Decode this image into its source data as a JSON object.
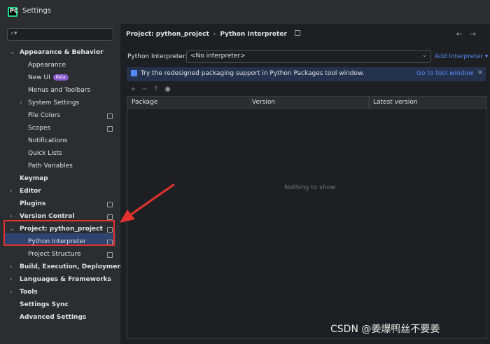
{
  "window": {
    "title": "Settings"
  },
  "sidebar": {
    "search_placeholder": "",
    "items": [
      {
        "label": "Appearance & Behavior",
        "level": 0,
        "expanded": true,
        "bold": true
      },
      {
        "label": "Appearance",
        "level": 1
      },
      {
        "label": "New UI",
        "level": 1,
        "badge": "Beta"
      },
      {
        "label": "Menus and Toolbars",
        "level": 1
      },
      {
        "label": "System Settings",
        "level": 1,
        "collapsed": true
      },
      {
        "label": "File Colors",
        "level": 1,
        "pin": true
      },
      {
        "label": "Scopes",
        "level": 1,
        "pin": true
      },
      {
        "label": "Notifications",
        "level": 1
      },
      {
        "label": "Quick Lists",
        "level": 1
      },
      {
        "label": "Path Variables",
        "level": 1
      },
      {
        "label": "Keymap",
        "level": 0,
        "bold": true
      },
      {
        "label": "Editor",
        "level": 0,
        "bold": true,
        "collapsed": true
      },
      {
        "label": "Plugins",
        "level": 0,
        "bold": true,
        "pin": true
      },
      {
        "label": "Version Control",
        "level": 0,
        "bold": true,
        "collapsed": true,
        "pin": true
      },
      {
        "label": "Project: python_project",
        "level": 0,
        "bold": true,
        "expanded": true,
        "pin": true
      },
      {
        "label": "Python Interpreter",
        "level": 1,
        "pin": true,
        "selected": true
      },
      {
        "label": "Project Structure",
        "level": 1,
        "pin": true
      },
      {
        "label": "Build, Execution, Deployment",
        "level": 0,
        "bold": true,
        "collapsed": true
      },
      {
        "label": "Languages & Frameworks",
        "level": 0,
        "bold": true,
        "collapsed": true
      },
      {
        "label": "Tools",
        "level": 0,
        "bold": true,
        "collapsed": true
      },
      {
        "label": "Settings Sync",
        "level": 0,
        "bold": true
      },
      {
        "label": "Advanced Settings",
        "level": 0,
        "bold": true
      }
    ]
  },
  "main": {
    "breadcrumb": [
      "Project: python_project",
      "Python Interpreter"
    ],
    "interpreter_label": "Python Interpreter:",
    "interpreter_value": "<No interpreter>",
    "add_interpreter": "Add Interpreter",
    "banner_text": "Try the redesigned packaging support in Python Packages tool window.",
    "banner_link": "Go to tool window",
    "columns": [
      "Package",
      "Version",
      "Latest version"
    ],
    "empty_text": "Nothing to show"
  },
  "watermark": "CSDN @姜爆鸭丝不要姜",
  "colors": {
    "accent": "#548af7",
    "selection": "#2e436e",
    "annotation": "#e3322d"
  }
}
